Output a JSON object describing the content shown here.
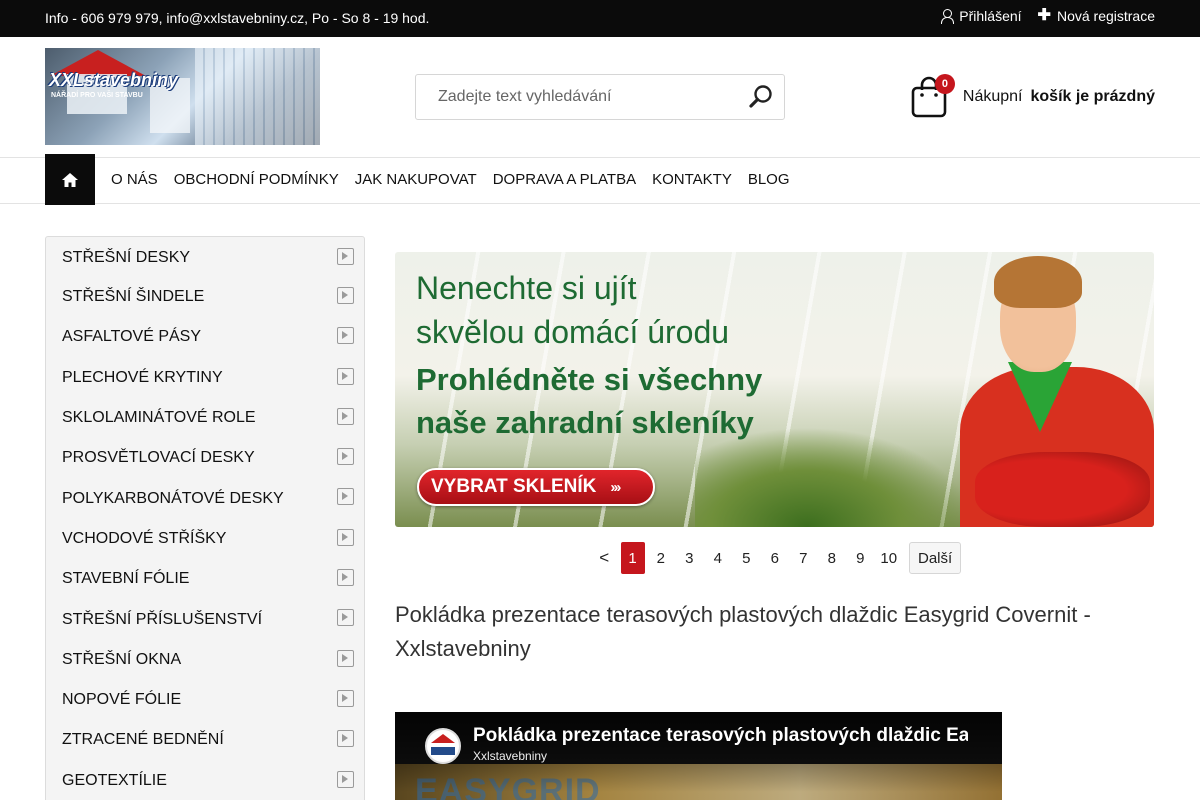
{
  "topbar": {
    "info": "Info - 606 979 979, info@xxlstavebniny.cz, Po - So 8 - 19 hod.",
    "login": "Přihlášení",
    "register": "Nová registrace"
  },
  "header": {
    "logo_text": "XXLstavebniny",
    "logo_sub": "NÁŘADÍ PRO VAŠI STAVBU",
    "search_placeholder": "Zadejte text vyhledávání",
    "cart_count": "0",
    "cart_label_1": "Nákupní",
    "cart_label_2": "košík je prázdný"
  },
  "nav": {
    "items": [
      "O NÁS",
      "OBCHODNÍ PODMÍNKY",
      "JAK NAKUPOVAT",
      "DOPRAVA A PLATBA",
      "KONTAKTY",
      "BLOG"
    ]
  },
  "sidebar": {
    "items": [
      "STŘEŠNÍ DESKY",
      "STŘEŠNÍ ŠINDELE",
      "ASFALTOVÉ PÁSY",
      "PLECHOVÉ KRYTINY",
      "SKLOLAMINÁTOVÉ ROLE",
      "PROSVĚTLOVACÍ DESKY",
      "POLYKARBONÁTOVÉ DESKY",
      "VCHODOVÉ STŘÍŠKY",
      "STAVEBNÍ FÓLIE",
      "STŘEŠNÍ PŘÍSLUŠENSTVÍ",
      "STŘEŠNÍ OKNA",
      "NOPOVÉ FÓLIE",
      "ZTRACENÉ BEDNĚNÍ",
      "GEOTEXTÍLIE"
    ]
  },
  "banner": {
    "line1": "Nenechte si ujít",
    "line2": "skvělou domácí úrodu",
    "line3": "Prohlédněte si všechny",
    "line4": "naše zahradní skleníky",
    "cta": "VYBRAT SKLENÍK",
    "cta_arrows": "›››"
  },
  "pager": {
    "prev": "<",
    "pages": [
      "1",
      "2",
      "3",
      "4",
      "5",
      "6",
      "7",
      "8",
      "9",
      "10"
    ],
    "active": "1",
    "next": "Další"
  },
  "article": {
    "title": "Pokládka prezentace terasových plastových dlaždic Easygrid Covernit - Xxlstavebniny"
  },
  "video": {
    "title": "Pokládka prezentace terasových plastových dlaždic Easygrid Covernit - Xxlstavebniny",
    "channel": "Xxlstavebniny",
    "thumb_text": "EASYGRID"
  },
  "colors": {
    "accent": "#c5161d",
    "dark": "#0b0b0b",
    "banner_green": "#1e6b33"
  }
}
